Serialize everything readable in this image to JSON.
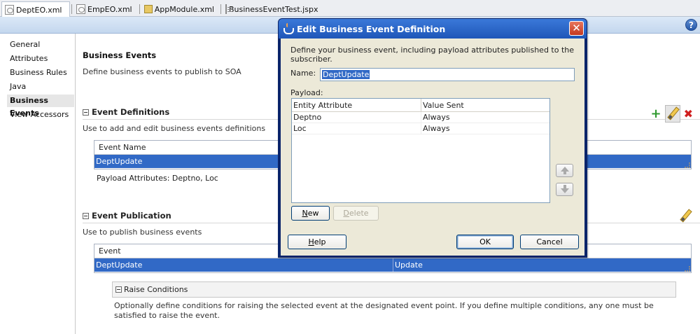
{
  "tabs": [
    {
      "label": "DeptEO.xml",
      "icon": "xml-file-icon",
      "active": true
    },
    {
      "label": "EmpEO.xml",
      "icon": "xml-file-icon",
      "active": false
    },
    {
      "label": "AppModule.xml",
      "icon": "folder-icon",
      "active": false
    },
    {
      "label": "BusinessEventTest.jspx",
      "icon": "page-icon",
      "active": false
    }
  ],
  "help_glyph": "?",
  "nav": {
    "items": [
      "General",
      "Attributes",
      "Business Rules",
      "Java",
      "Business Events",
      "View Accessors"
    ],
    "selected": "Business Events"
  },
  "main": {
    "title": "Business Events",
    "description": "Define business events to publish to SOA",
    "definitions": {
      "title": "Event Definitions",
      "description": "Use to add and edit business events definitions",
      "column": "Event Name",
      "rows": [
        "DeptUpdate"
      ],
      "payload_label": "Payload Attributes:",
      "payload_value": "Deptno, Loc"
    },
    "publication": {
      "title": "Event Publication",
      "description": "Use to publish business events",
      "column": "Event",
      "rows": [
        {
          "event": "DeptUpdate",
          "point": "Update"
        }
      ]
    },
    "raise": {
      "title": "Raise Conditions",
      "description": "Optionally define conditions for raising the selected event at the designated event point. If you define multiple conditions, any one must be satisfied to raise the event."
    }
  },
  "dialog": {
    "title": "Edit Business Event Definition",
    "close_glyph": "✕",
    "description": "Define your business event, including payload attributes published to the subscriber.",
    "name_label": "Name:",
    "name_value": "DeptUpdate",
    "payload_label": "Payload:",
    "payload_columns": [
      "Entity Attribute",
      "Value Sent"
    ],
    "payload_rows": [
      {
        "attribute": "Deptno",
        "value": "Always"
      },
      {
        "attribute": "Loc",
        "value": "Always"
      }
    ],
    "new_button": {
      "mnemonic": "N",
      "rest": "ew"
    },
    "delete_button": {
      "mnemonic": "D",
      "rest": "elete"
    },
    "help_button": {
      "mnemonic": "H",
      "rest": "elp"
    },
    "ok_button": "OK",
    "cancel_button": "Cancel"
  },
  "colors": {
    "selection": "#3169c6",
    "dialog_title": "#1f56b8",
    "add_icon": "#2f9a2f",
    "delete_icon": "#d01f1f"
  }
}
